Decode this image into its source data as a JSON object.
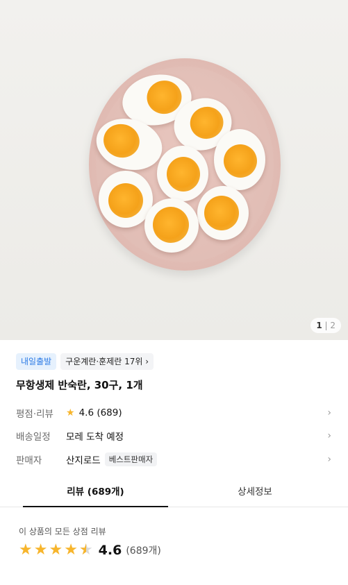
{
  "gallery": {
    "current": "1",
    "total": "2"
  },
  "badges": {
    "delivery": "내일출발",
    "ranking": "구운계란·훈제란 17위 ›"
  },
  "product": {
    "title": "무항생제 반숙란, 30구, 1개"
  },
  "info": {
    "rating_label": "평점·리뷰",
    "rating_value": "4.6 (689)",
    "shipping_label": "배송일정",
    "shipping_value": "모레 도착 예정",
    "seller_label": "판매자",
    "seller_value": "산지로드",
    "seller_badge": "베스트판매자"
  },
  "tabs": {
    "reviews": "리뷰 (689개)",
    "details": "상세정보"
  },
  "review_summary": {
    "subtitle": "이 상품의 모든 상점 리뷰",
    "score": "4.6",
    "count": "(689개)",
    "rating": 4.6
  },
  "colors": {
    "accent_star": "#f7b52c",
    "badge_blue": "#2c7be5"
  }
}
